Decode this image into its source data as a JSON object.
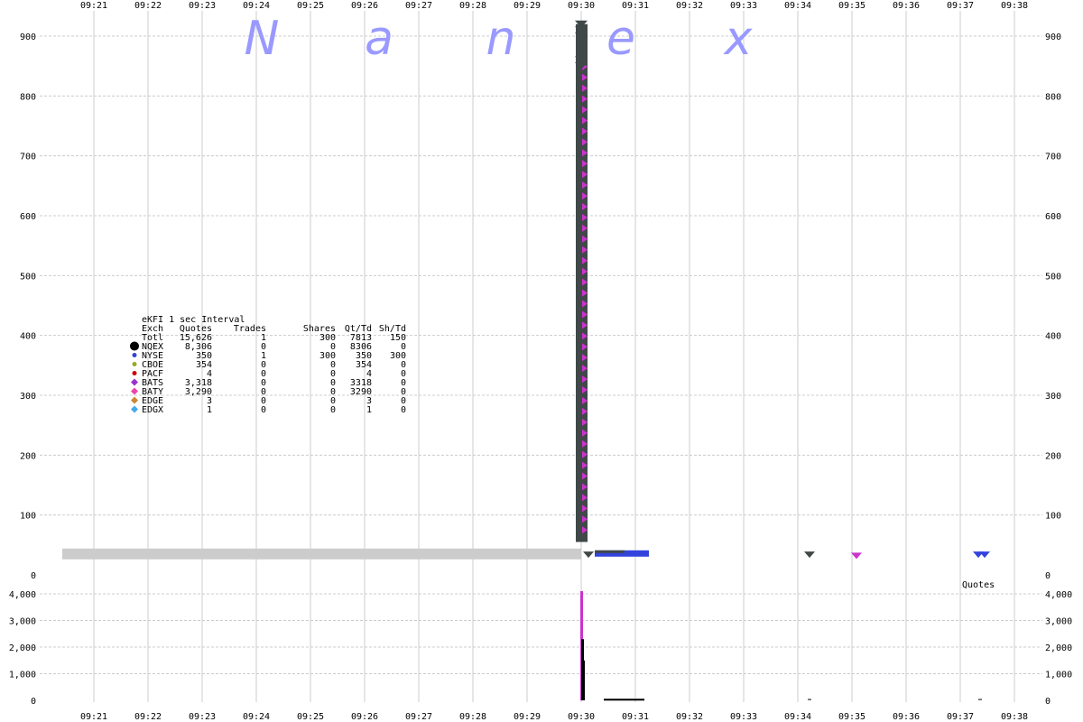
{
  "watermark": {
    "letters": [
      "N",
      "a",
      "n",
      "e",
      "x"
    ],
    "color": "#9999ff"
  },
  "chart_data": {
    "type": "scatter",
    "x_ticks": [
      "09:21",
      "09:22",
      "09:23",
      "09:24",
      "09:25",
      "09:26",
      "09:27",
      "09:28",
      "09:29",
      "09:30",
      "09:31",
      "09:32",
      "09:33",
      "09:34",
      "09:35",
      "09:36",
      "09:37",
      "09:38"
    ],
    "quotes_panel": {
      "label": "Quotes",
      "ylim": [
        0,
        950
      ],
      "y_ticks": [
        0,
        100,
        200,
        300,
        400,
        500,
        600,
        700,
        800,
        900
      ],
      "spike": {
        "time": "09:30:00",
        "from": 55,
        "to": 920,
        "color": "#404848"
      },
      "spike_overlay_color": "#cc33cc",
      "nbbo_bar": {
        "from": "09:20:25",
        "to": "09:30:00",
        "value": 35,
        "color": "#cccccc"
      },
      "post_band": {
        "from": "09:30:15",
        "to": "09:31:15",
        "value": 35,
        "color": "#3344dd"
      },
      "points": [
        {
          "time": "09:30:08",
          "value": 33,
          "color": "#404848"
        },
        {
          "time": "09:34:13",
          "value": 33,
          "color": "#404848"
        },
        {
          "time": "09:35:05",
          "value": 31,
          "color": "#cc33cc"
        },
        {
          "time": "09:37:20",
          "value": 33,
          "color": "#3344dd"
        },
        {
          "time": "09:37:27",
          "value": 33,
          "color": "#3344dd"
        }
      ]
    },
    "volume_panel": {
      "ylim": [
        0,
        4300
      ],
      "y_ticks": [
        "0",
        "1,000",
        "2,000",
        "3,000",
        "4,000"
      ],
      "y_tick_values": [
        0,
        1000,
        2000,
        3000,
        4000
      ],
      "bars": [
        {
          "time": "09:30:00",
          "value": 4100,
          "color": "#cc33cc"
        },
        {
          "time": "09:30:01",
          "value": 2300,
          "color": "#000000"
        },
        {
          "time": "09:30:02",
          "value": 1500,
          "color": "#000000"
        }
      ],
      "baseline_band": {
        "from": "09:30:25",
        "to": "09:31:10",
        "value": 25,
        "color": "#000000"
      },
      "tiny_marks": [
        {
          "time": "09:34:13",
          "value": 15
        },
        {
          "time": "09:37:22",
          "value": 15
        }
      ]
    },
    "legend": {
      "title": "eKFI 1 sec Interval",
      "headers": [
        "Exch",
        "Quotes",
        "Trades",
        "Shares",
        "Qt/Td",
        "Sh/Td"
      ],
      "rows": [
        {
          "exch": "Totl",
          "quotes": "15,626",
          "trades": "1",
          "shares": "300",
          "qt_td": "7813",
          "sh_td": "150",
          "marker": "none",
          "color": ""
        },
        {
          "exch": "NQEX",
          "quotes": "8,306",
          "trades": "0",
          "shares": "0",
          "qt_td": "8306",
          "sh_td": "0",
          "marker": "big-circle",
          "color": "#000000"
        },
        {
          "exch": "NYSE",
          "quotes": "350",
          "trades": "1",
          "shares": "300",
          "qt_td": "350",
          "sh_td": "300",
          "marker": "circle",
          "color": "#3344cc"
        },
        {
          "exch": "CBOE",
          "quotes": "354",
          "trades": "0",
          "shares": "0",
          "qt_td": "354",
          "sh_td": "0",
          "marker": "circle",
          "color": "#99aa22"
        },
        {
          "exch": "PACF",
          "quotes": "4",
          "trades": "0",
          "shares": "0",
          "qt_td": "4",
          "sh_td": "0",
          "marker": "circle",
          "color": "#cc0000"
        },
        {
          "exch": "BATS",
          "quotes": "3,318",
          "trades": "0",
          "shares": "0",
          "qt_td": "3318",
          "sh_td": "0",
          "marker": "diamond",
          "color": "#9933cc"
        },
        {
          "exch": "BATY",
          "quotes": "3,290",
          "trades": "0",
          "shares": "0",
          "qt_td": "3290",
          "sh_td": "0",
          "marker": "diamond",
          "color": "#ee44aa"
        },
        {
          "exch": "EDGE",
          "quotes": "3",
          "trades": "0",
          "shares": "0",
          "qt_td": "3",
          "sh_td": "0",
          "marker": "diamond",
          "color": "#cc8833"
        },
        {
          "exch": "EDGX",
          "quotes": "1",
          "trades": "0",
          "shares": "0",
          "qt_td": "1",
          "sh_td": "0",
          "marker": "diamond",
          "color": "#44aaee"
        }
      ]
    },
    "grid": true
  }
}
